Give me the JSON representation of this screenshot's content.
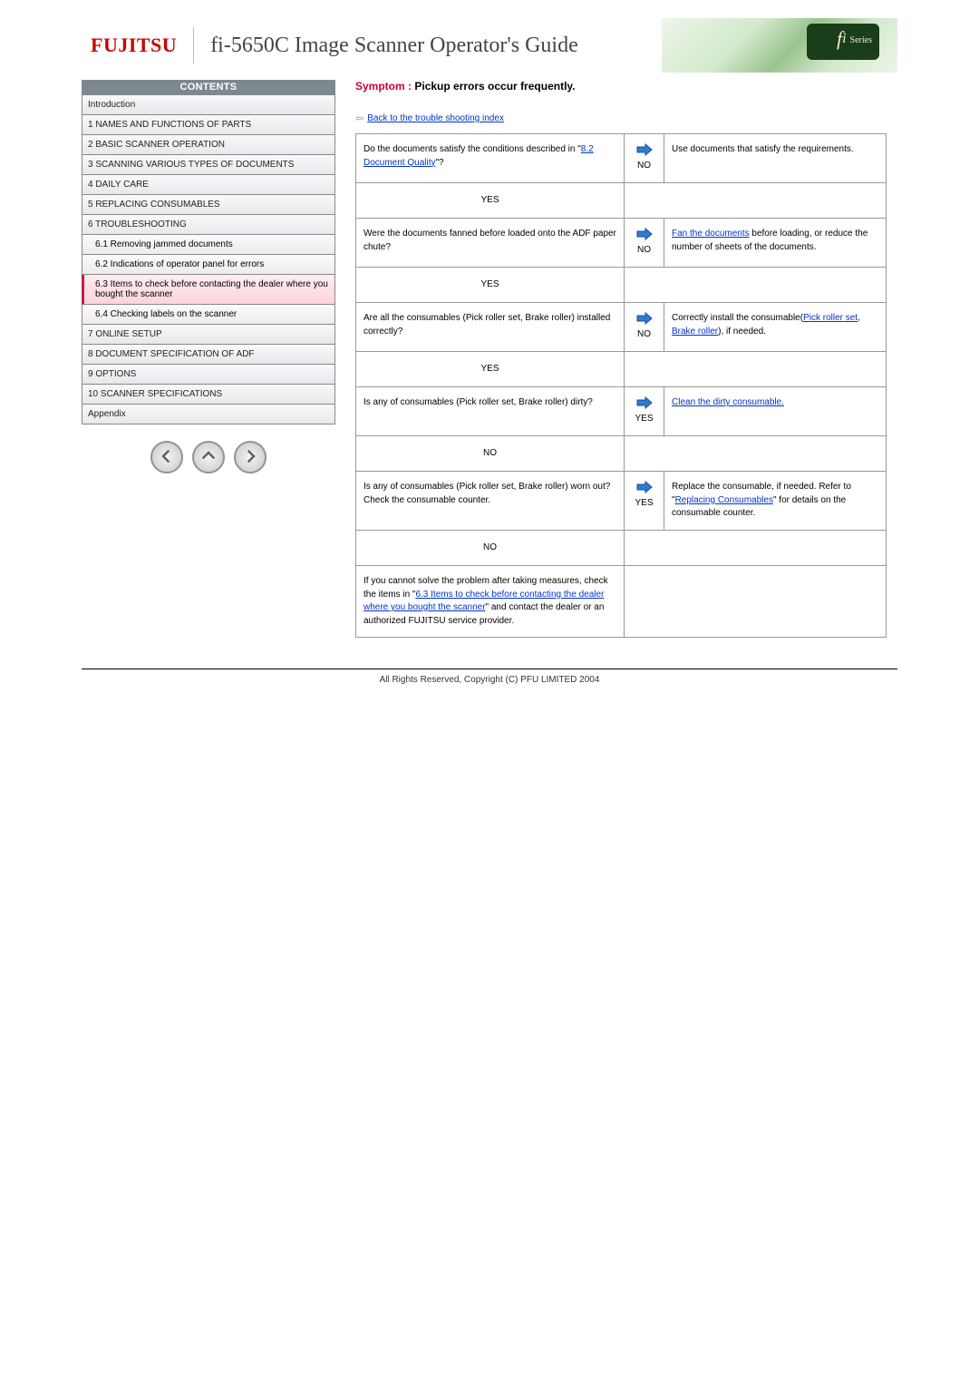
{
  "header": {
    "logo": "FUJITSU",
    "title": "fi-5650C Image Scanner Operator's Guide",
    "series_label": "fi Series"
  },
  "sidebar": {
    "contents_header": "CONTENTS",
    "items": [
      "Introduction",
      "1 NAMES AND FUNCTIONS OF PARTS",
      "2 BASIC SCANNER OPERATION",
      "3 SCANNING VARIOUS TYPES OF DOCUMENTS",
      "4 DAILY CARE",
      "5 REPLACING CONSUMABLES",
      "6 TROUBLESHOOTING"
    ],
    "sub_items": [
      "6.1 Removing jammed documents",
      "6.2 Indications of operator panel for errors",
      "6.3 Items to check before contacting the dealer where you bought the scanner",
      "6.4 Checking labels on the scanner"
    ],
    "items2": [
      "7 ONLINE SETUP",
      "8 DOCUMENT SPECIFICATION OF ADF",
      "9 OPTIONS",
      "10 SCANNER SPECIFICATIONS",
      "Appendix"
    ]
  },
  "main": {
    "symptom_label": "Symptom :",
    "symptom_text": " Pickup errors occur frequently.",
    "back_link": "Back to the trouble shooting index",
    "yes": "YES",
    "no": "NO",
    "rows": [
      {
        "q_pre": "Do the documents satisfy the conditions described in \"",
        "q_link": "8.2 Document Quality",
        "q_post": "\"?",
        "cond": "NO",
        "a": "Use documents that satisfy the requirements.",
        "next": "YES"
      },
      {
        "q": "Were the documents fanned before loaded onto the ADF paper chute?",
        "cond": "NO",
        "a_link": "Fan the documents",
        "a_post": " before loading, or reduce the number of sheets of the documents.",
        "next": "YES"
      },
      {
        "q": "Are all the consumables (Pick roller set, Brake roller) installed correctly?",
        "cond": "NO",
        "a_pre": "Correctly install the consumable(",
        "a_link1": "Pick roller set",
        "a_mid": ", ",
        "a_link2": "Brake roller",
        "a_post": "), if needed.",
        "next": "YES"
      },
      {
        "q": "Is any of consumables (Pick roller set, Brake roller) dirty?",
        "cond": "YES",
        "a_link": "Clean the dirty consumable.",
        "next": "NO"
      },
      {
        "q": "Is any of consumables (Pick roller set, Brake roller) worn out? Check the consumable counter.",
        "cond": "YES",
        "a_pre": "Replace the consumable, if needed. Refer to \"",
        "a_link": "Replacing Consumables",
        "a_post": "\" for details on the consumable counter.",
        "next": "NO"
      }
    ],
    "final_pre": "If you cannot solve the problem after taking measures, check the items in \"",
    "final_link": "6.3 Items to check before contacting the dealer where you bought the scanner",
    "final_post": "\" and contact the dealer or an authorized FUJITSU service provider."
  },
  "footer": "All Rights Reserved, Copyright (C) PFU LIMITED 2004"
}
